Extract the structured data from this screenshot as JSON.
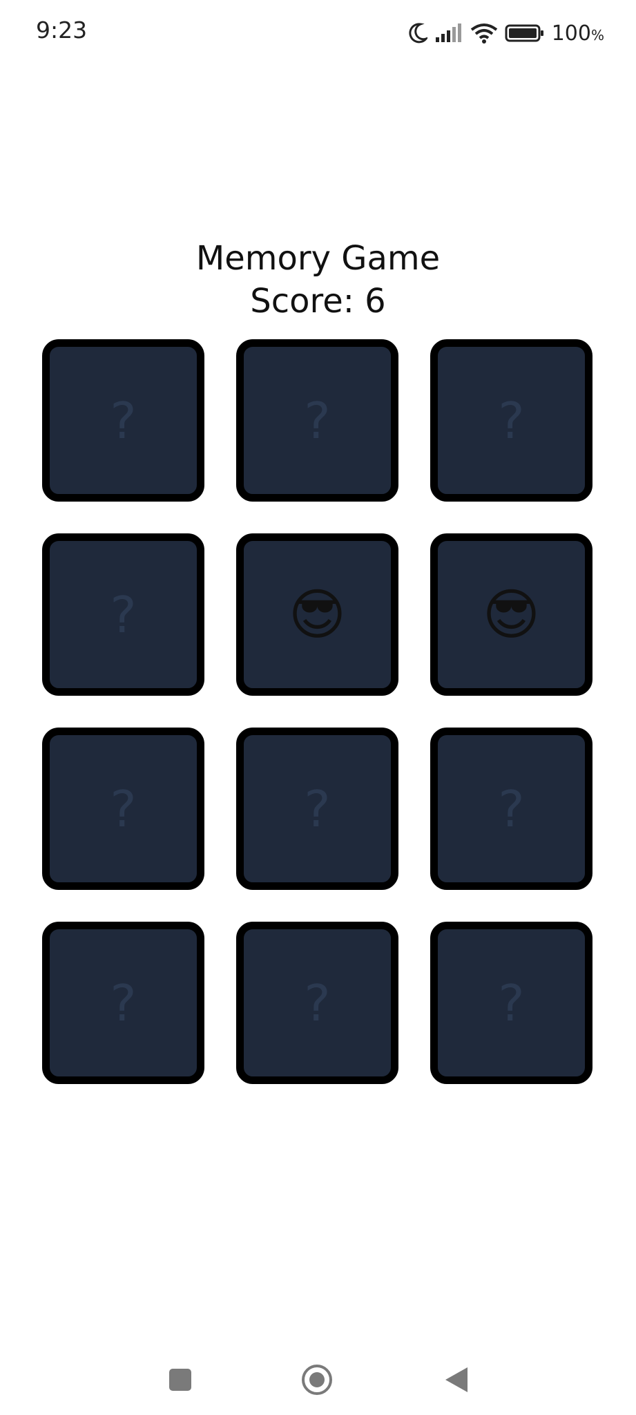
{
  "status_bar": {
    "time": "9:23",
    "battery_percent": "100",
    "battery_unit": "%",
    "icons": [
      "moon-icon",
      "signal-icon",
      "wifi-icon",
      "battery-icon"
    ]
  },
  "header": {
    "title": "Memory Game",
    "score_label": "Score: 6"
  },
  "board": {
    "columns": 3,
    "rows": 4,
    "card_color": "#1f293b",
    "card_border_color": "#000000",
    "hidden_mark_color": "#2b3950",
    "cards": [
      {
        "state": "hidden",
        "content": "?"
      },
      {
        "state": "hidden",
        "content": "?"
      },
      {
        "state": "hidden",
        "content": "?"
      },
      {
        "state": "hidden",
        "content": "?"
      },
      {
        "state": "revealed",
        "content": "😎"
      },
      {
        "state": "revealed",
        "content": "😎"
      },
      {
        "state": "hidden",
        "content": "?"
      },
      {
        "state": "hidden",
        "content": "?"
      },
      {
        "state": "hidden",
        "content": "?"
      },
      {
        "state": "hidden",
        "content": "?"
      },
      {
        "state": "hidden",
        "content": "?"
      },
      {
        "state": "hidden",
        "content": "?"
      }
    ]
  },
  "nav_bar": {
    "buttons": [
      "recents-square-icon",
      "home-circle-icon",
      "back-triangle-icon"
    ]
  }
}
